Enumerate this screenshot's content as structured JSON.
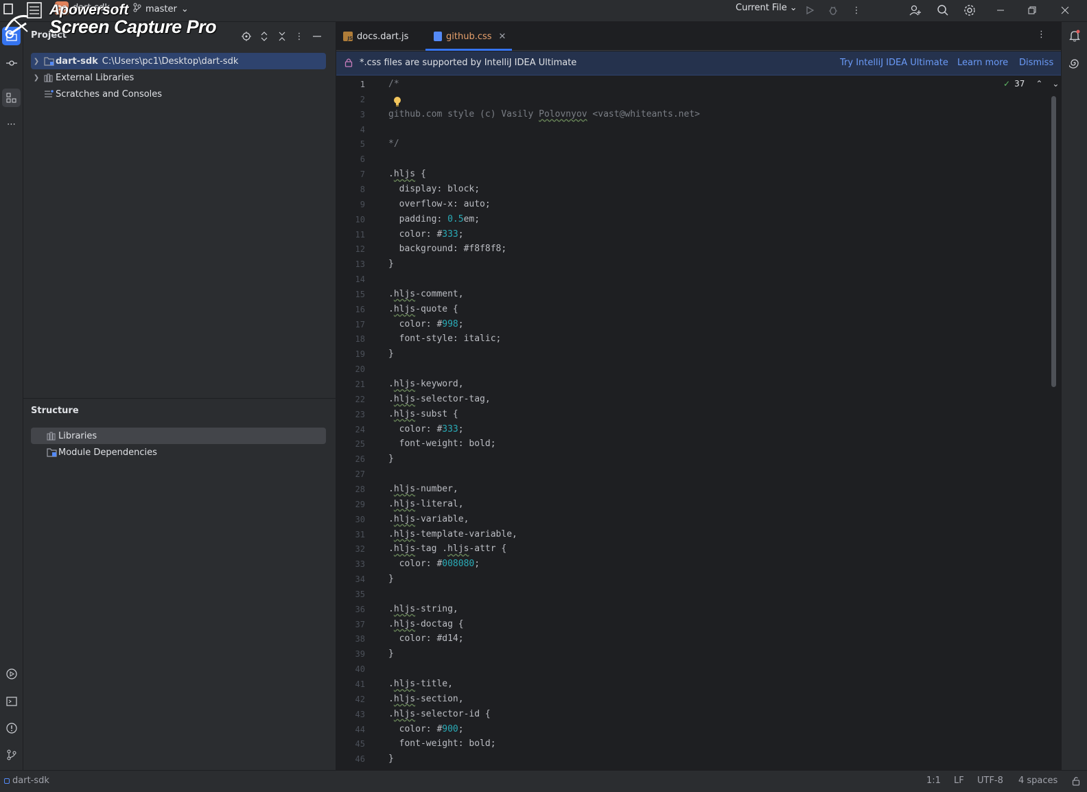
{
  "watermark": {
    "line1": "Apowersoft",
    "line2": "Screen Capture Pro"
  },
  "titlebar": {
    "project_badge": "DS",
    "project_name": "dart-sdk",
    "branch": "master",
    "run_config": "Current File"
  },
  "project_panel": {
    "title": "Project",
    "tree": [
      {
        "name": "dart-sdk",
        "path": "C:\\Users\\pc1\\Desktop\\dart-sdk",
        "icon": "folder-module-icon",
        "expandable": true,
        "selected": true
      },
      {
        "name": "External Libraries",
        "icon": "libraries-icon",
        "expandable": true
      },
      {
        "name": "Scratches and Consoles",
        "icon": "scratches-icon",
        "expandable": false
      }
    ]
  },
  "structure_panel": {
    "title": "Structure",
    "items": [
      {
        "name": "Libraries",
        "icon": "libraries-icon",
        "selected": true
      },
      {
        "name": "Module Dependencies",
        "icon": "module-deps-icon"
      }
    ]
  },
  "editor": {
    "tabs": [
      {
        "label": "docs.dart.js",
        "icon": "js-file-icon"
      },
      {
        "label": "github.css",
        "icon": "css-file-icon",
        "active": true,
        "closable": true
      }
    ],
    "banner": {
      "text": "*.css files are supported by IntelliJ IDEA Ultimate",
      "try_link": "Try IntelliJ IDEA Ultimate",
      "learn_link": "Learn more",
      "dismiss_link": "Dismiss"
    },
    "inspections_count": "37",
    "current_line": 1,
    "lines": [
      "/*",
      "",
      "github.com style (c) Vasily Polovnyov <vast@whiteants.net>",
      "",
      "*/",
      "",
      ".hljs {",
      "  display: block;",
      "  overflow-x: auto;",
      "  padding: 0.5em;",
      "  color: #333;",
      "  background: #f8f8f8;",
      "}",
      "",
      ".hljs-comment,",
      ".hljs-quote {",
      "  color: #998;",
      "  font-style: italic;",
      "}",
      "",
      ".hljs-keyword,",
      ".hljs-selector-tag,",
      ".hljs-subst {",
      "  color: #333;",
      "  font-weight: bold;",
      "}",
      "",
      ".hljs-number,",
      ".hljs-literal,",
      ".hljs-variable,",
      ".hljs-template-variable,",
      ".hljs-tag .hljs-attr {",
      "  color: #008080;",
      "}",
      "",
      ".hljs-string,",
      ".hljs-doctag {",
      "  color: #d14;",
      "}",
      "",
      ".hljs-title,",
      ".hljs-section,",
      ".hljs-selector-id {",
      "  color: #900;",
      "  font-weight: bold;",
      "}"
    ]
  },
  "statusbar": {
    "project": "dart-sdk",
    "position": "1:1",
    "line_sep": "LF",
    "encoding": "UTF-8",
    "indent": "4 spaces"
  },
  "colors": {
    "accent": "#3574f0",
    "link": "#6b9bf8",
    "number": "#2aacb8",
    "comment": "#7a7e85",
    "active_tab_text": "#e8a16c"
  }
}
